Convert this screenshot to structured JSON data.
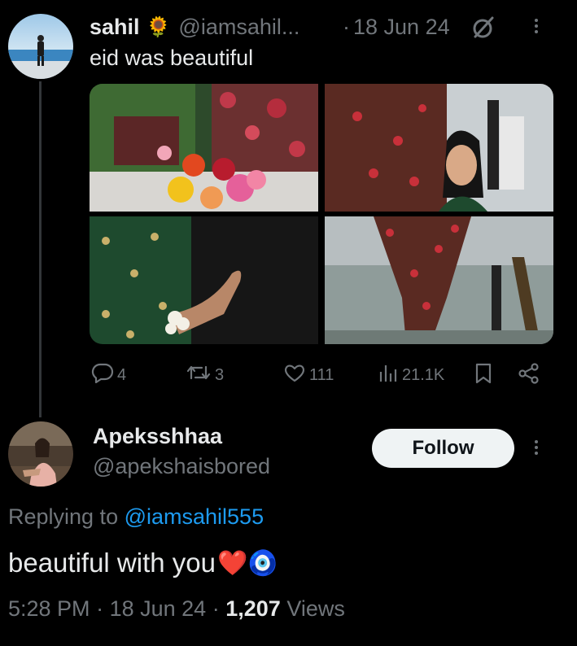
{
  "tweet": {
    "author_name": "sahil",
    "author_emoji": "🌻",
    "author_handle": "@iamsahil...",
    "separator": "·",
    "date": "18 Jun 24",
    "text": "eid was beautiful",
    "stats": {
      "replies": "4",
      "reposts": "3",
      "likes": "111",
      "views": "21.1K"
    }
  },
  "reply": {
    "author_name": "Apeksshhaa",
    "author_handle": "@apekshaisbored",
    "follow_label": "Follow",
    "replying_prefix": "Replying to ",
    "replying_handle": "@iamsahil555",
    "text": "beautiful with you",
    "text_emojis": "❤️🧿",
    "time": "5:28 PM",
    "date": "18 Jun 24",
    "separator": "·",
    "views_count": "1,207",
    "views_label": "Views"
  },
  "colors": {
    "background": "#000000",
    "text": "#e7e9ea",
    "muted": "#71767b",
    "link": "#1d9bf0",
    "follow_bg": "#eff3f4"
  },
  "icons": [
    "grok-icon",
    "more-icon",
    "reply-icon",
    "repost-icon",
    "like-icon",
    "views-icon",
    "bookmark-icon",
    "share-icon"
  ]
}
